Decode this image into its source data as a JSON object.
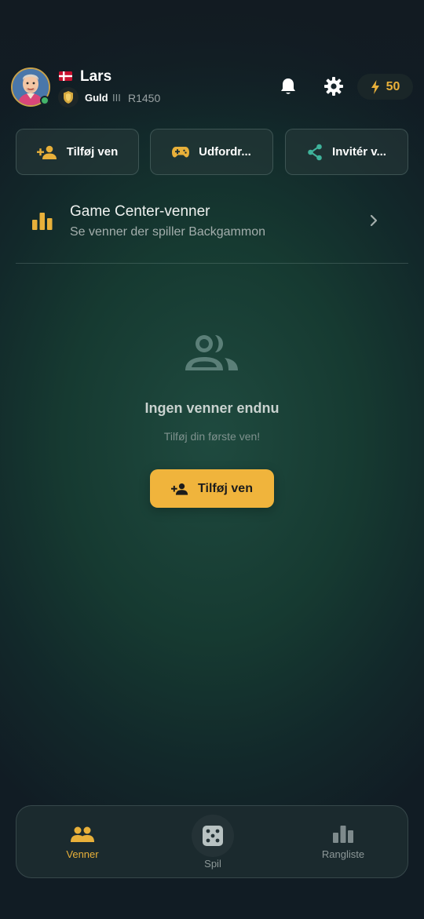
{
  "header": {
    "username": "Lars",
    "country": "Denmark",
    "rank": "Guld",
    "rank_tier": "III",
    "rating": "R1450",
    "energy": "50",
    "online": true,
    "colors": {
      "energy": "#e8b03a",
      "online": "#43b46a"
    }
  },
  "actions": [
    {
      "label": "Tilføj ven",
      "icon": "add-person-icon"
    },
    {
      "label": "Udfordr...",
      "icon": "gamepad-icon"
    },
    {
      "label": "Invitér v...",
      "icon": "share-icon"
    }
  ],
  "game_center": {
    "title": "Game Center-venner",
    "subtitle": "Se venner der spiller Backgammon",
    "icon": "bar-chart-icon"
  },
  "empty_state": {
    "title": "Ingen venner endnu",
    "subtitle": "Tilføj din første ven!",
    "button_label": "Tilføj ven",
    "icon": "people-icon"
  },
  "bottom_nav": {
    "active": "Venner",
    "items": [
      {
        "label": "Venner",
        "icon": "people-icon"
      },
      {
        "label": "Spil",
        "icon": "dice-icon"
      },
      {
        "label": "Rangliste",
        "icon": "leaderboard-icon"
      }
    ]
  },
  "colors": {
    "accent": "#f0b43c",
    "teal_icon": "#3fb39b"
  }
}
